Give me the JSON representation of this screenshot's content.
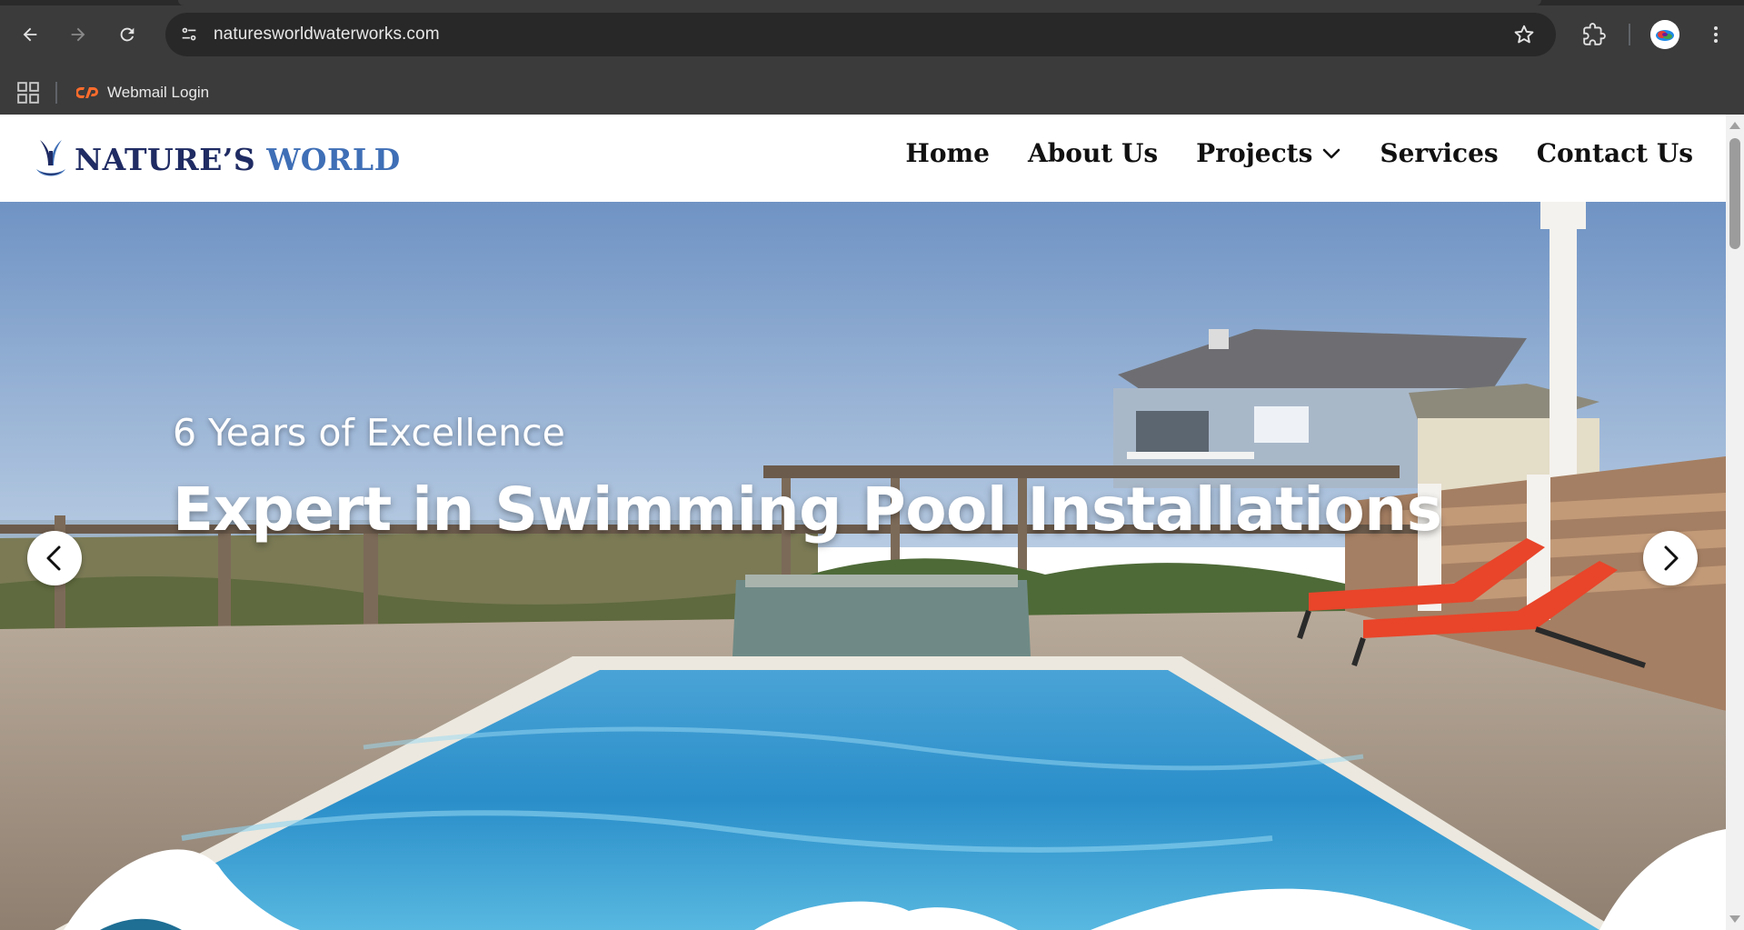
{
  "browser": {
    "url": "naturesworldwaterworks.com",
    "bookmarks": [
      {
        "label": "Webmail Login",
        "icon": "cpanel-icon"
      }
    ],
    "colors": {
      "chrome": "#3b3b3b",
      "omnibox": "#282828"
    }
  },
  "site": {
    "logo": {
      "part1": "NATURE’S",
      "part2": "WORLD"
    },
    "nav": {
      "home": "Home",
      "about": "About Us",
      "projects": "Projects",
      "services": "Services",
      "contact": "Contact Us"
    },
    "hero": {
      "subtitle": "6 Years of Excellence",
      "title": "Expert in Swimming Pool Installations"
    },
    "colors": {
      "logo_dark": "#1f2b63",
      "logo_light": "#3f6fb6",
      "nav_text": "#111111"
    }
  }
}
